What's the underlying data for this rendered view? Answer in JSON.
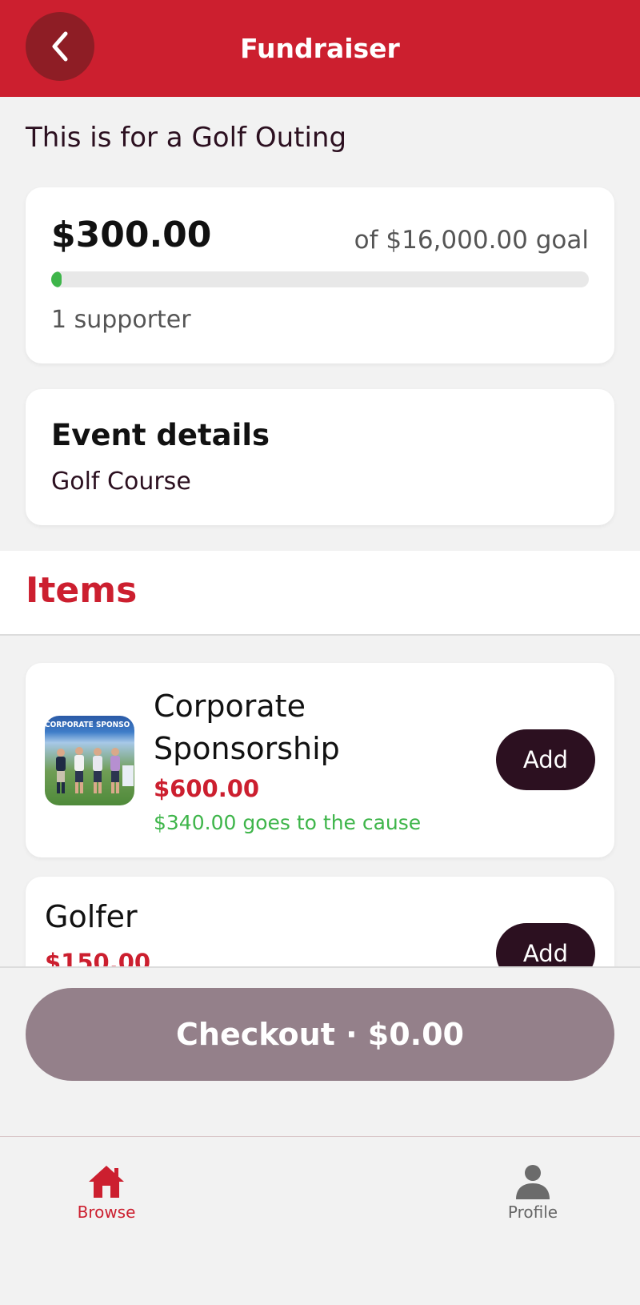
{
  "header": {
    "title": "Fundraiser",
    "back_icon": "chevron-left-icon"
  },
  "subtitle": "This is for a Golf Outing",
  "goal": {
    "raised": "$300.00",
    "goal_text": "of $16,000.00 goal",
    "progress_fraction": 0.01875,
    "supporters": "1 supporter"
  },
  "event": {
    "title": "Event details",
    "location": "Golf Course"
  },
  "items_section": {
    "title": "Items"
  },
  "items": [
    {
      "name": "Corporate Sponsorship",
      "price": "$600.00",
      "cause": "$340.00 goes to the cause",
      "thumb_banner": "CORPORATE SPONSO",
      "add_label": "Add"
    },
    {
      "name": "Golfer",
      "price": "$150.00",
      "add_label": "Add"
    }
  ],
  "checkout": {
    "label": "Checkout · $0.00"
  },
  "tabs": [
    {
      "label": "Browse",
      "icon": "home-icon",
      "active": true
    },
    {
      "label": "Profile",
      "icon": "person-icon",
      "active": false
    }
  ],
  "colors": {
    "brand_red": "#cc1f2f",
    "dark_plum": "#2c1020",
    "progress_green": "#3eb54a",
    "checkout_disabled": "#94808a"
  }
}
